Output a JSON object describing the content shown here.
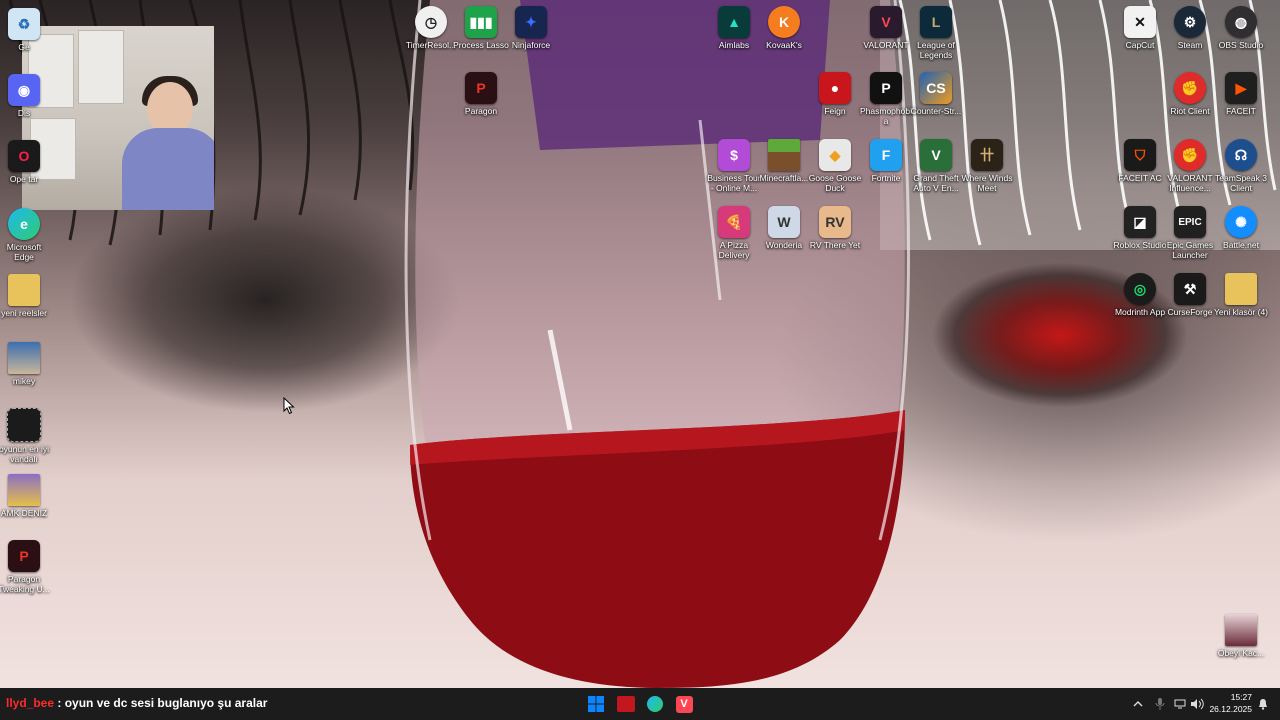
{
  "chat": {
    "username": "llyd_bee",
    "separator": " : ",
    "message": "oyun ve dc sesi buglanıyo şu aralar"
  },
  "clock": {
    "time": "15:27",
    "date": "26.12.2025"
  },
  "left_icons": [
    {
      "name": "Recycle Bin",
      "label": "Ge"
    },
    {
      "name": "Discord",
      "label": "Dis"
    },
    {
      "name": "Opera GX",
      "label": "Ope tar"
    },
    {
      "name": "Microsoft Edge",
      "label": "Microsoft Edge"
    },
    {
      "name": "yeni reelsler",
      "label": "yeni reelsler"
    },
    {
      "name": "mikey",
      "label": "mikey"
    },
    {
      "name": "oyunun en iyi vandalı",
      "label": "oyunun en iyi vandalı"
    },
    {
      "name": "AMK DENIZ",
      "label": "AMK DENIZ"
    },
    {
      "name": "Paragon Tweaking U...",
      "label": "Paragon Tweaking U..."
    }
  ],
  "top_icons": [
    {
      "name": "TimerResolution",
      "label": "TimerResol..."
    },
    {
      "name": "Process Lasso",
      "label": "Process Lasso"
    },
    {
      "name": "Ninjaforce",
      "label": "Ninjaforce"
    },
    {
      "name": "Paragon",
      "label": "Paragon"
    },
    {
      "name": "Aimlabs",
      "label": "Aimlabs"
    },
    {
      "name": "KovaaK's",
      "label": "KovaaK's"
    },
    {
      "name": "VALORANT",
      "label": "VALORANT"
    },
    {
      "name": "League of Legends",
      "label": "League of Legends"
    },
    {
      "name": "Feign",
      "label": "Feign"
    },
    {
      "name": "Phasmophobia",
      "label": "Phasmophobia"
    },
    {
      "name": "Counter-Strike 2",
      "label": "Counter-Str..."
    },
    {
      "name": "Business Tour",
      "label": "Business Tour - Online M..."
    },
    {
      "name": "Minecraft Launcher",
      "label": "Minecraftla..."
    },
    {
      "name": "Goose Goose Duck",
      "label": "Goose Goose Duck"
    },
    {
      "name": "Fortnite",
      "label": "Fortnite"
    },
    {
      "name": "Grand Theft Auto V",
      "label": "Grand Theft Auto V En..."
    },
    {
      "name": "Where Winds Meet",
      "label": "Where Winds Meet"
    },
    {
      "name": "A Pizza Delivery",
      "label": "A Pizza Delivery"
    },
    {
      "name": "Wonderia",
      "label": "Wonderia"
    },
    {
      "name": "RV There Yet",
      "label": "RV There Yet"
    }
  ],
  "right_icons": [
    {
      "name": "CapCut",
      "label": "CapCut"
    },
    {
      "name": "Steam",
      "label": "Steam"
    },
    {
      "name": "OBS Studio",
      "label": "OBS Studio"
    },
    {
      "name": "Riot Client",
      "label": "Riot Client"
    },
    {
      "name": "FACEIT",
      "label": "FACEIT"
    },
    {
      "name": "FACEIT AC",
      "label": "FACEIT AC"
    },
    {
      "name": "VALORANT Influence",
      "label": "VALORANT Influence..."
    },
    {
      "name": "TeamSpeak 3 Client",
      "label": "TeamSpeak 3 Client"
    },
    {
      "name": "Roblox Studio",
      "label": "Roblox Studio"
    },
    {
      "name": "Epic Games Launcher",
      "label": "Epic Games Launcher"
    },
    {
      "name": "Battle.net",
      "label": "Battle.net"
    },
    {
      "name": "Modrinth App",
      "label": "Modrinth App"
    },
    {
      "name": "CurseForge",
      "label": "CurseForge"
    },
    {
      "name": "Yeni klasör (4)",
      "label": "Yeni klasör (4)"
    },
    {
      "name": "Obeyl Kac",
      "label": "Obeyl Kac..."
    }
  ],
  "colors": {
    "taskbar": "#1c1c1c",
    "chat_user": "#ff2a2a",
    "windows_blue": "#0a84ff"
  }
}
